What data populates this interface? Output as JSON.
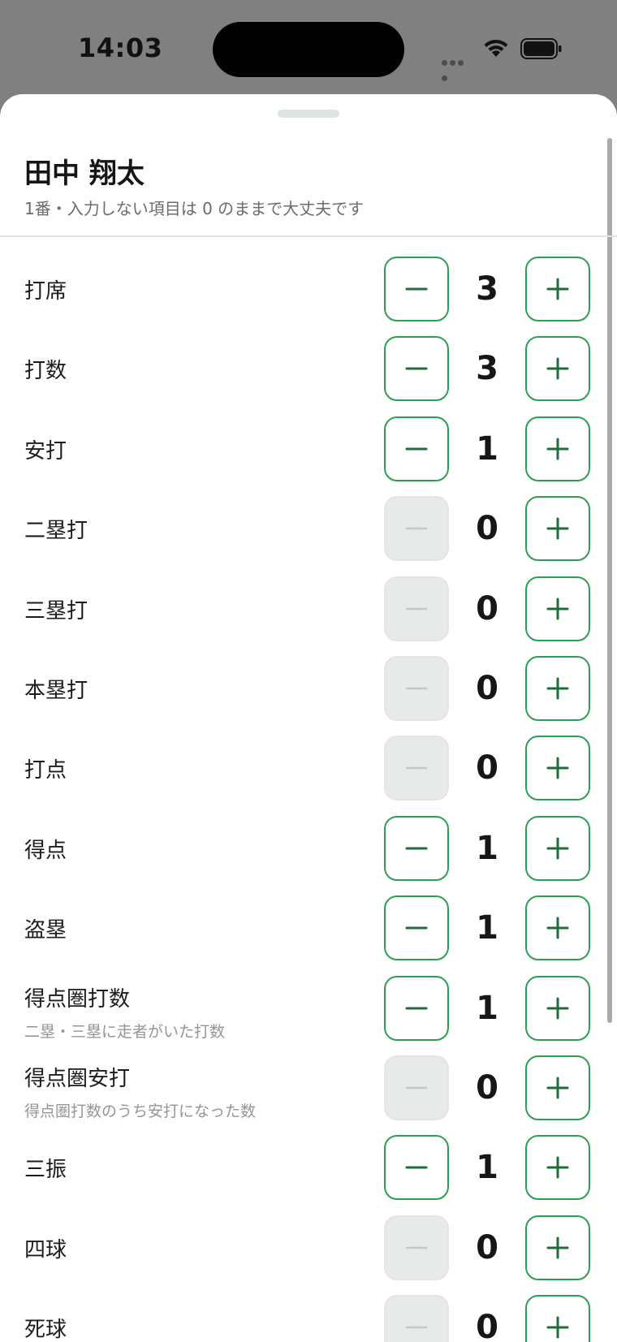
{
  "status_bar": {
    "time": "14:03"
  },
  "header": {
    "player_name": "田中 翔太",
    "subtitle": "1番・入力しない項目は 0 のままで大丈夫です"
  },
  "colors": {
    "accent": "#2e9e52",
    "accent_icon": "#1f6e39",
    "disabled_bg": "#e8eae9",
    "disabled_icon": "#c4c8c6"
  },
  "icons": {
    "minus": "minus-icon",
    "plus": "plus-icon"
  },
  "stats": [
    {
      "label": "打席",
      "value": "3",
      "hint": "",
      "minus_enabled": true
    },
    {
      "label": "打数",
      "value": "3",
      "hint": "",
      "minus_enabled": true
    },
    {
      "label": "安打",
      "value": "1",
      "hint": "",
      "minus_enabled": true
    },
    {
      "label": "二塁打",
      "value": "0",
      "hint": "",
      "minus_enabled": false
    },
    {
      "label": "三塁打",
      "value": "0",
      "hint": "",
      "minus_enabled": false
    },
    {
      "label": "本塁打",
      "value": "0",
      "hint": "",
      "minus_enabled": false
    },
    {
      "label": "打点",
      "value": "0",
      "hint": "",
      "minus_enabled": false
    },
    {
      "label": "得点",
      "value": "1",
      "hint": "",
      "minus_enabled": true
    },
    {
      "label": "盗塁",
      "value": "1",
      "hint": "",
      "minus_enabled": true
    },
    {
      "label": "得点圏打数",
      "value": "1",
      "hint": "二塁・三塁に走者がいた打数",
      "minus_enabled": true
    },
    {
      "label": "得点圏安打",
      "value": "0",
      "hint": "得点圏打数のうち安打になった数",
      "minus_enabled": false
    },
    {
      "label": "三振",
      "value": "1",
      "hint": "",
      "minus_enabled": true
    },
    {
      "label": "四球",
      "value": "0",
      "hint": "",
      "minus_enabled": false
    },
    {
      "label": "死球",
      "value": "0",
      "hint": "",
      "minus_enabled": false
    }
  ]
}
